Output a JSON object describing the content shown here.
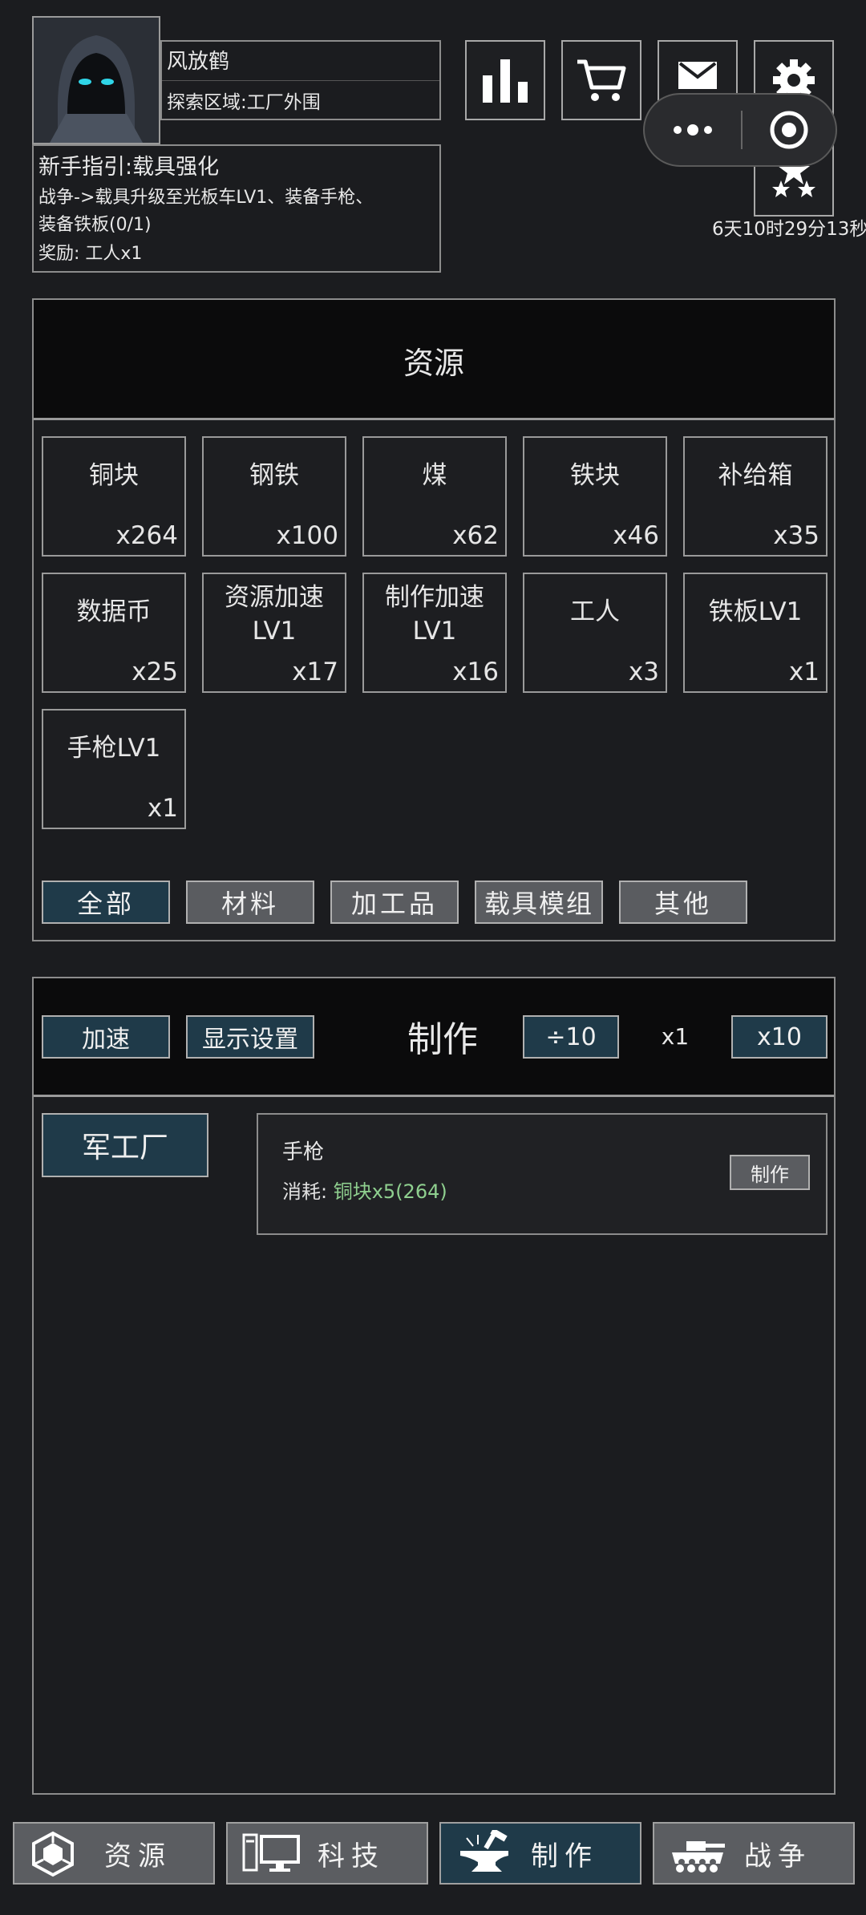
{
  "player": {
    "name": "风放鹤",
    "area": "探索区域:工厂外围"
  },
  "guide": {
    "title": "新手指引:载具强化",
    "line1": "战争->载具升级至光板车LV1、装备手枪、",
    "line2": "装备铁板(0/1)",
    "reward": "奖励: 工人x1"
  },
  "timer": "6天10时29分13秒",
  "resources": {
    "title": "资源",
    "items": [
      {
        "name": "铜块",
        "count": "x264"
      },
      {
        "name": "钢铁",
        "count": "x100"
      },
      {
        "name": "煤",
        "count": "x62"
      },
      {
        "name": "铁块",
        "count": "x46"
      },
      {
        "name": "补给箱",
        "count": "x35"
      },
      {
        "name": "数据币",
        "count": "x25"
      },
      {
        "name": "资源加速\nLV1",
        "count": "x17"
      },
      {
        "name": "制作加速\nLV1",
        "count": "x16"
      },
      {
        "name": "工人",
        "count": "x3"
      },
      {
        "name": "铁板LV1",
        "count": "x1"
      },
      {
        "name": "手枪LV1",
        "count": "x1"
      }
    ],
    "filters": [
      "全部",
      "材料",
      "加工品",
      "载具模组",
      "其他"
    ]
  },
  "craft": {
    "title": "制作",
    "speed_label": "加速",
    "display_label": "显示设置",
    "div_label": "÷10",
    "mult_value": "x1",
    "mul_label": "x10",
    "factory_label": "军工厂",
    "recipe": {
      "name": "手枪",
      "cost_prefix": "消耗: ",
      "cost_value": "铜块x5(264)",
      "button": "制作"
    }
  },
  "nav": [
    "资源",
    "科技",
    "制作",
    "战争"
  ],
  "colors": {
    "background": "#1b1c1f",
    "panel_header": "#0b0b0c",
    "active_button": "#1f3a49",
    "inactive_button": "#5a5c60",
    "cost_green": "#8fd08f"
  }
}
